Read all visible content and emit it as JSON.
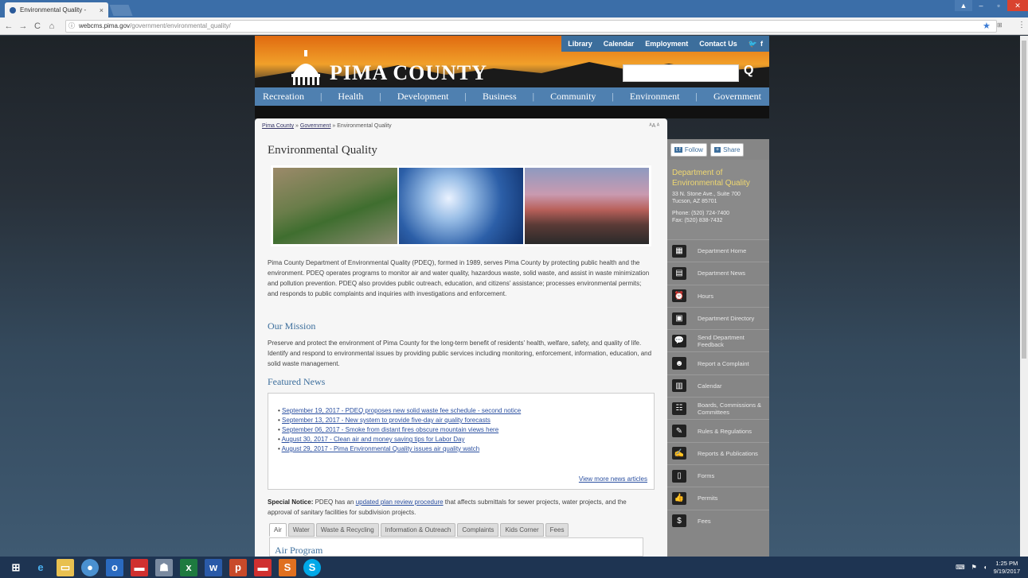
{
  "browser": {
    "tab_title": "Environmental Quality - ",
    "tab_close": "×",
    "url_host": "webcms.pima.gov",
    "url_path": "/government/environmental_quality/",
    "back": "←",
    "forward": "→",
    "reload": "C",
    "home": "⌂",
    "star": "★",
    "menu": "⋮",
    "win_min": "–",
    "win_max": "▫",
    "win_close": "✕"
  },
  "header": {
    "top_links": [
      "Library",
      "Calendar",
      "Employment",
      "Contact Us"
    ],
    "site_title": "PIMA COUNTY",
    "search_placeholder": "",
    "nav": [
      "Recreation",
      "Health",
      "Development",
      "Business",
      "Community",
      "Environment",
      "Government"
    ]
  },
  "breadcrumb": {
    "items": [
      "Pima County",
      "Government",
      "Environmental Quality"
    ],
    "sep": " » ",
    "text_size": "ᴬA ᴬ"
  },
  "page": {
    "title": "Environmental Quality",
    "intro": "Pima County Department of Environmental Quality (PDEQ), formed in 1989, serves Pima County by protecting public health and the environment. PDEQ operates programs to monitor air and water quality, hazardous waste, solid waste, and assist in waste minimization and pollution prevention. PDEQ also provides public outreach, education, and citizens' assistance; processes environmental permits; and responds to public complaints and inquiries with investigations and enforcement.",
    "mission_heading": "Our Mission",
    "mission_text": "Preserve and protect the environment of Pima County for the long-term benefit of residents' health, welfare, safety, and quality of life. Identify and respond to environmental issues by providing public services including monitoring, enforcement, information, education, and solid waste management.",
    "news_heading": "Featured News",
    "news": [
      "September 19, 2017 - PDEQ proposes new solid waste fee schedule - second notice",
      "September 13, 2017 - New system to provide five-day air quality forecasts",
      "September 06, 2017 - Smoke from distant fires obscure mountain views here",
      "August 30, 2017 - Clean air and money saving tips for Labor Day",
      "August 29, 2017 - Pima Environmental Quality issues air quality watch"
    ],
    "more_news": "View more news articles",
    "notice_label": "Special Notice:",
    "notice_pre": " PDEQ has an ",
    "notice_link": "updated plan review procedure",
    "notice_post": " that affects submittals for sewer projects, water projects, and the approval of sanitary facilities for subdivision projects.",
    "tabs": [
      "Air",
      "Water",
      "Waste & Recycling",
      "Information & Outreach",
      "Complaints",
      "Kids Corner",
      "Fees"
    ],
    "tab_heading": "Air Program"
  },
  "sidebar": {
    "follow": "Follow",
    "share": "Share",
    "dept_name": "Department of Environmental Quality",
    "address1": "33 N. Stone Ave., Suite 700",
    "address2": "Tucson, AZ 85701",
    "phone": "Phone: (520) 724-7400",
    "fax": "Fax: (520) 838-7432",
    "items": [
      "Department Home",
      "Department News",
      "Hours",
      "Department Directory",
      "Send Department Feedback",
      "Report a Complaint",
      "Calendar",
      "Boards, Commissions & Committees",
      "Rules & Regulations",
      "Reports & Publications",
      "Forms",
      "Permits",
      "Fees"
    ]
  },
  "taskbar": {
    "time": "1:25 PM",
    "date": "9/19/2017"
  },
  "colors": {
    "nav_blue": "#4f80b0",
    "sidebar_gray": "#868686",
    "link_blue": "#2a4fa0",
    "heading_blue": "#3c6e9c"
  }
}
